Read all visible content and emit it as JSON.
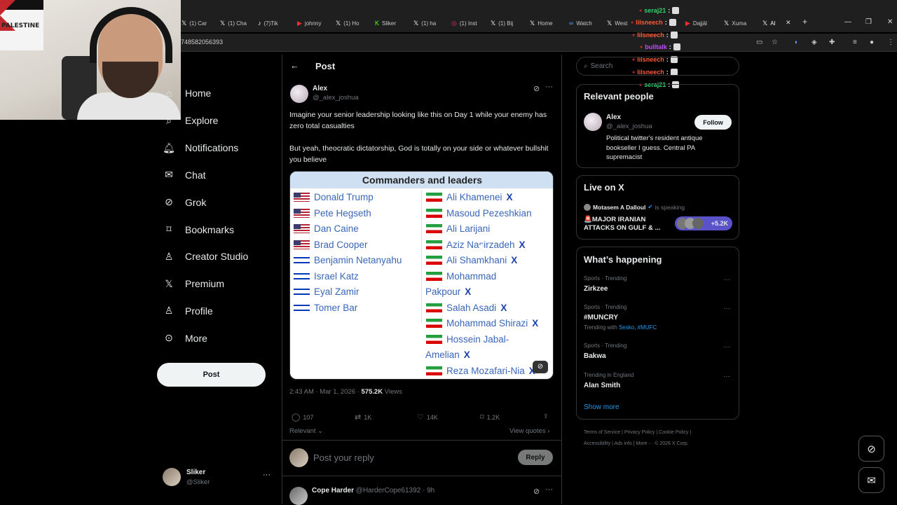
{
  "browser": {
    "tabs": [
      {
        "label": "(1) Car",
        "icon": "x-logo"
      },
      {
        "label": "(1) Cha",
        "icon": "x-logo"
      },
      {
        "label": "(7)Tik",
        "icon": "tiktok-logo"
      },
      {
        "label": "johnny",
        "icon": "youtube-logo"
      },
      {
        "label": "(1) Ho",
        "icon": "x-logo"
      },
      {
        "label": "Sliker",
        "icon": "kick-logo"
      },
      {
        "label": "(1) ha",
        "icon": "x-logo"
      },
      {
        "label": "(1) Inst",
        "icon": "instagram-logo"
      },
      {
        "label": "(1) Bij",
        "icon": "x-logo"
      },
      {
        "label": "Home",
        "icon": "x-logo"
      },
      {
        "label": "Watch",
        "icon": "watch-logo"
      },
      {
        "label": "West",
        "icon": "x-logo"
      },
      {
        "label": "Dajjāl",
        "icon": "youtube-logo"
      },
      {
        "label": "Xuma",
        "icon": "x-logo"
      },
      {
        "label": "Al",
        "icon": "x-logo"
      }
    ],
    "url_fragment": "748582056393"
  },
  "chat_overlay": [
    {
      "user": "seraj21",
      "color": "#2fd36a"
    },
    {
      "user": "lilsneech",
      "color": "#ff5a36"
    },
    {
      "user": "lilsneech",
      "color": "#ff5a36"
    },
    {
      "user": "bulltalk",
      "color": "#c24cff"
    },
    {
      "user": "lilsneech",
      "color": "#ff5a36"
    },
    {
      "user": "lilsneech",
      "color": "#ff5a36"
    },
    {
      "user": "seraj21",
      "color": "#2fd36a"
    }
  ],
  "left_nav": {
    "items": [
      {
        "label": "Home",
        "icon": "home-icon"
      },
      {
        "label": "Explore",
        "icon": "search-icon"
      },
      {
        "label": "Notifications",
        "icon": "bell-icon"
      },
      {
        "label": "Chat",
        "icon": "mail-icon"
      },
      {
        "label": "Grok",
        "icon": "grok-icon"
      },
      {
        "label": "Bookmarks",
        "icon": "bookmark-icon"
      },
      {
        "label": "Creator Studio",
        "icon": "creator-icon"
      },
      {
        "label": "Premium",
        "icon": "x-logo-icon"
      },
      {
        "label": "Profile",
        "icon": "person-icon"
      },
      {
        "label": "More",
        "icon": "more-circle-icon"
      }
    ],
    "post_button": "Post",
    "account": {
      "name": "Sliker",
      "handle": "@Sliker"
    }
  },
  "post": {
    "header_title": "Post",
    "author_name": "Alex",
    "author_handle": "@_alex_joshua",
    "text_1": "Imagine your senior leadership looking like this on Day 1 while your enemy has zero total casualties",
    "text_2": "But yeah, theocratic dictatorship, God is totally on your side or whatever bullshit you believe",
    "image": {
      "title": "Commanders and leaders",
      "left_column": [
        {
          "name": "Donald Trump",
          "flag": "us"
        },
        {
          "name": "Pete Hegseth",
          "flag": "us"
        },
        {
          "name": "Dan Caine",
          "flag": "us"
        },
        {
          "name": "Brad Cooper",
          "flag": "us"
        },
        {
          "name": "Benjamin Netanyahu",
          "flag": "il"
        },
        {
          "name": "Israel Katz",
          "flag": "il"
        },
        {
          "name": "Eyal Zamir",
          "flag": "il"
        },
        {
          "name": "Tomer Bar",
          "flag": "il"
        }
      ],
      "right_column": [
        {
          "name": "Ali Khamenei",
          "flag": "ir",
          "marked": "X"
        },
        {
          "name": "Masoud Pezeshkian",
          "flag": "ir",
          "marked": ""
        },
        {
          "name": "Ali Larijani",
          "flag": "ir",
          "marked": ""
        },
        {
          "name": "Aziz Nasirzadeh",
          "flag": "ir",
          "marked": "X"
        },
        {
          "name": "Ali Shamkhani",
          "flag": "ir",
          "marked": "X"
        },
        {
          "name": "Mohammad",
          "flag": "ir",
          "marked": ""
        },
        {
          "name": "Pakpour",
          "flag": "",
          "marked": "X"
        },
        {
          "name": "Salah Asadi",
          "flag": "ir",
          "marked": "X"
        },
        {
          "name": "Mohammad Shirazi",
          "flag": "ir",
          "marked": "X"
        },
        {
          "name": "Hossein Jabal-",
          "flag": "ir",
          "marked": ""
        },
        {
          "name": "Amelian",
          "flag": "",
          "marked": "X"
        },
        {
          "name": "Reza Mozafari-Nia",
          "flag": "ir",
          "marked": "X"
        }
      ]
    },
    "timestamp": "2:43 AM · Mar 1, 2026 · ",
    "views_count": "575.2K",
    "views_label": " Views",
    "stats": {
      "replies": "107",
      "reposts": "1K",
      "likes": "14K",
      "bookmarks": "1.2K"
    },
    "sort_label": "Relevant",
    "view_quotes": "View quotes",
    "reply_placeholder": "Post your reply",
    "reply_button": "Reply",
    "next_reply": {
      "name": "Cope Harder",
      "handle": "@HarderCope61392",
      "time": "· 9h"
    }
  },
  "right_col": {
    "search_placeholder": "Search",
    "relevant_title": "Relevant people",
    "person": {
      "name": "Alex",
      "handle": "@_alex_joshua",
      "follow": "Follow",
      "bio": "Political twitter's resident antique bookseller I guess. Central PA supremacist"
    },
    "live_title": "Live on X",
    "live": {
      "host": "Motasem A Dalloul",
      "speaking": "is speaking",
      "title": "🚨MAJOR IRANIAN ATTACKS ON GULF & ...",
      "count": "+5.2K"
    },
    "happening_title": "What’s happening",
    "trends": [
      {
        "category": "Sports · Trending",
        "name": "Zirkzee",
        "with": ""
      },
      {
        "category": "Sports · Trending",
        "name": "#MUNCRY",
        "with": "Trending with Sesko, #MUFC"
      },
      {
        "category": "Sports · Trending",
        "name": "Bakwa",
        "with": ""
      },
      {
        "category": "Trending in England",
        "name": "Alan Smith",
        "with": ""
      }
    ],
    "show_more": "Show more",
    "footer_1": "Terms of Service  |  Privacy Policy  |  Cookie Policy  |",
    "footer_2": "Accessibility  |  Ads info  |  More ···  © 2026 X Corp."
  }
}
